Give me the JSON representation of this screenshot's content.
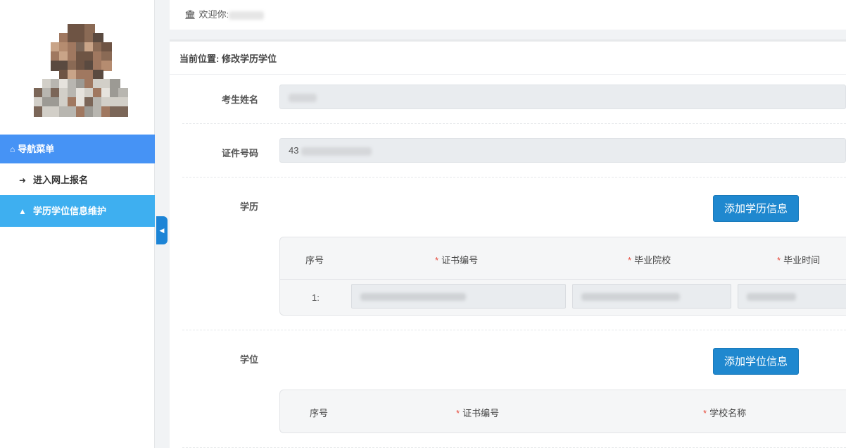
{
  "sidebar": {
    "nav_header": {
      "icon": "home-icon",
      "label": "导航菜单"
    },
    "items": [
      {
        "icon": "sign-in-icon",
        "label": "进入网上报名",
        "active": false
      },
      {
        "icon": "graduation-cap-icon",
        "label": "学历学位信息维护",
        "active": true
      }
    ]
  },
  "topbar": {
    "icon": "bank-icon",
    "welcome_label": "欢迎你:"
  },
  "breadcrumb": {
    "label": "当前位置: 修改学历学位"
  },
  "form": {
    "name_label": "考生姓名",
    "id_label": "证件号码",
    "id_value": "43",
    "education_label": "学历",
    "degree_label": "学位"
  },
  "education": {
    "add_button": "添加学历信息",
    "columns": [
      "序号",
      "证书编号",
      "毕业院校",
      "毕业时间"
    ],
    "required_mark": "*",
    "rows": [
      {
        "index": "1:"
      }
    ]
  },
  "degree": {
    "add_button": "添加学位信息",
    "columns": [
      "序号",
      "证书编号",
      "学校名称"
    ]
  },
  "colors": {
    "primary": "#1f88cf",
    "nav_header": "#4693f5",
    "nav_active": "#3eaff0",
    "required": "#e64a3b"
  }
}
